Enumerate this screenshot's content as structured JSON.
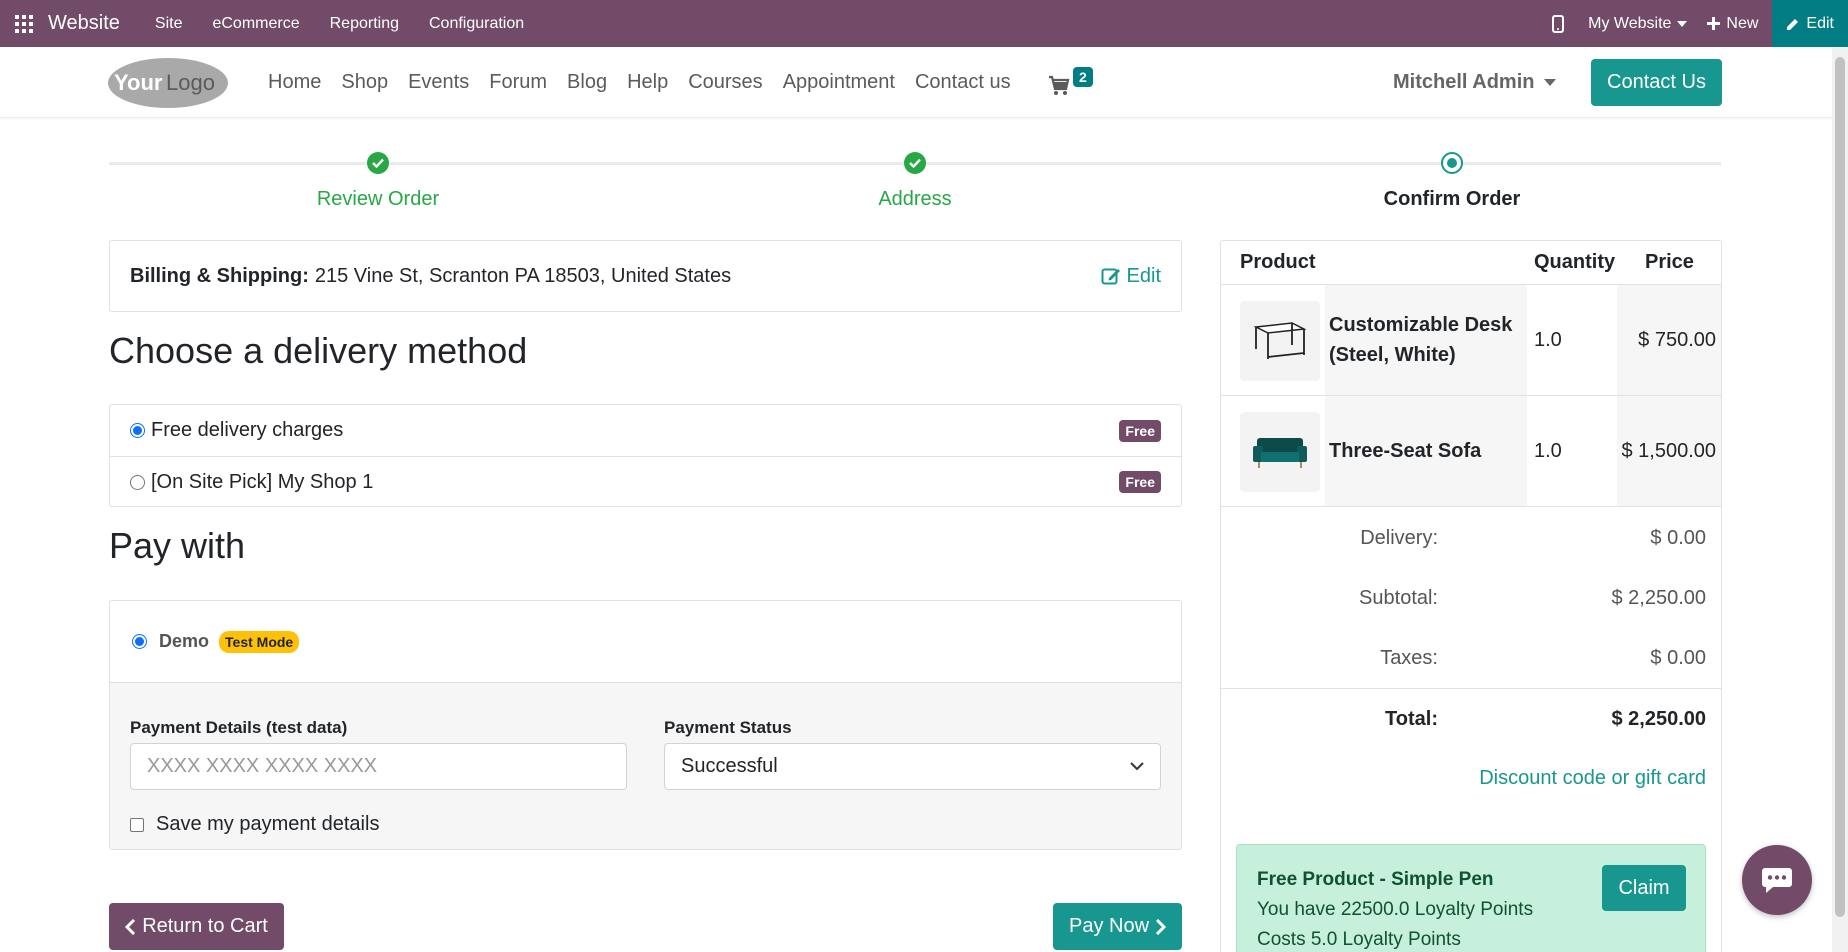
{
  "admin_bar": {
    "app_name": "Website",
    "menu": [
      "Site",
      "eCommerce",
      "Reporting",
      "Configuration"
    ],
    "website_selector": "My Website",
    "new_label": "New",
    "edit_label": "Edit"
  },
  "header": {
    "nav": [
      "Home",
      "Shop",
      "Events",
      "Forum",
      "Blog",
      "Help",
      "Courses",
      "Appointment",
      "Contact us"
    ],
    "cart_count": "2",
    "user_name": "Mitchell Admin",
    "contact_button": "Contact Us"
  },
  "progress": {
    "steps": [
      {
        "label": "Review Order",
        "state": "done"
      },
      {
        "label": "Address",
        "state": "done"
      },
      {
        "label": "Confirm Order",
        "state": "current"
      }
    ]
  },
  "billing": {
    "label": "Billing & Shipping:",
    "address": "215 Vine St, Scranton PA 18503, United States",
    "edit_label": "Edit"
  },
  "delivery": {
    "title": "Choose a delivery method",
    "options": [
      {
        "label": "Free delivery charges",
        "badge": "Free",
        "selected": true
      },
      {
        "label": "[On Site Pick] My Shop 1",
        "badge": "Free",
        "selected": false
      }
    ]
  },
  "payment": {
    "title": "Pay with",
    "provider": "Demo",
    "provider_badge": "Test Mode",
    "details_label": "Payment Details (test data)",
    "details_placeholder": "XXXX XXXX XXXX XXXX",
    "status_label": "Payment Status",
    "status_value": "Successful",
    "save_label": "Save my payment details"
  },
  "actions": {
    "return_label": "Return to Cart",
    "pay_label": "Pay Now"
  },
  "summary": {
    "headers": {
      "product": "Product",
      "quantity": "Quantity",
      "price": "Price"
    },
    "products": [
      {
        "name_line1": "Customizable Desk",
        "name_line2": "(Steel, White)",
        "quantity": "1.0",
        "price": "$ 750.00"
      },
      {
        "name_line1": "Three-Seat Sofa",
        "name_line2": "",
        "quantity": "1.0",
        "price": "$ 1,500.00"
      }
    ],
    "delivery_label": "Delivery:",
    "delivery_value": "$ 0.00",
    "subtotal_label": "Subtotal:",
    "subtotal_value": "$ 2,250.00",
    "taxes_label": "Taxes:",
    "taxes_value": "$ 0.00",
    "total_label": "Total:",
    "total_value": "$ 2,250.00",
    "discount_link": "Discount code or gift card"
  },
  "promo": {
    "title": "Free Product - Simple Pen",
    "line1": "You have 22500.0 Loyalty Points",
    "line2": "Costs 5.0 Loyalty Points",
    "claim_label": "Claim"
  },
  "colors": {
    "brand": "#714B67",
    "accent": "#17978f",
    "success": "#28a745",
    "warning": "#ffc107"
  }
}
